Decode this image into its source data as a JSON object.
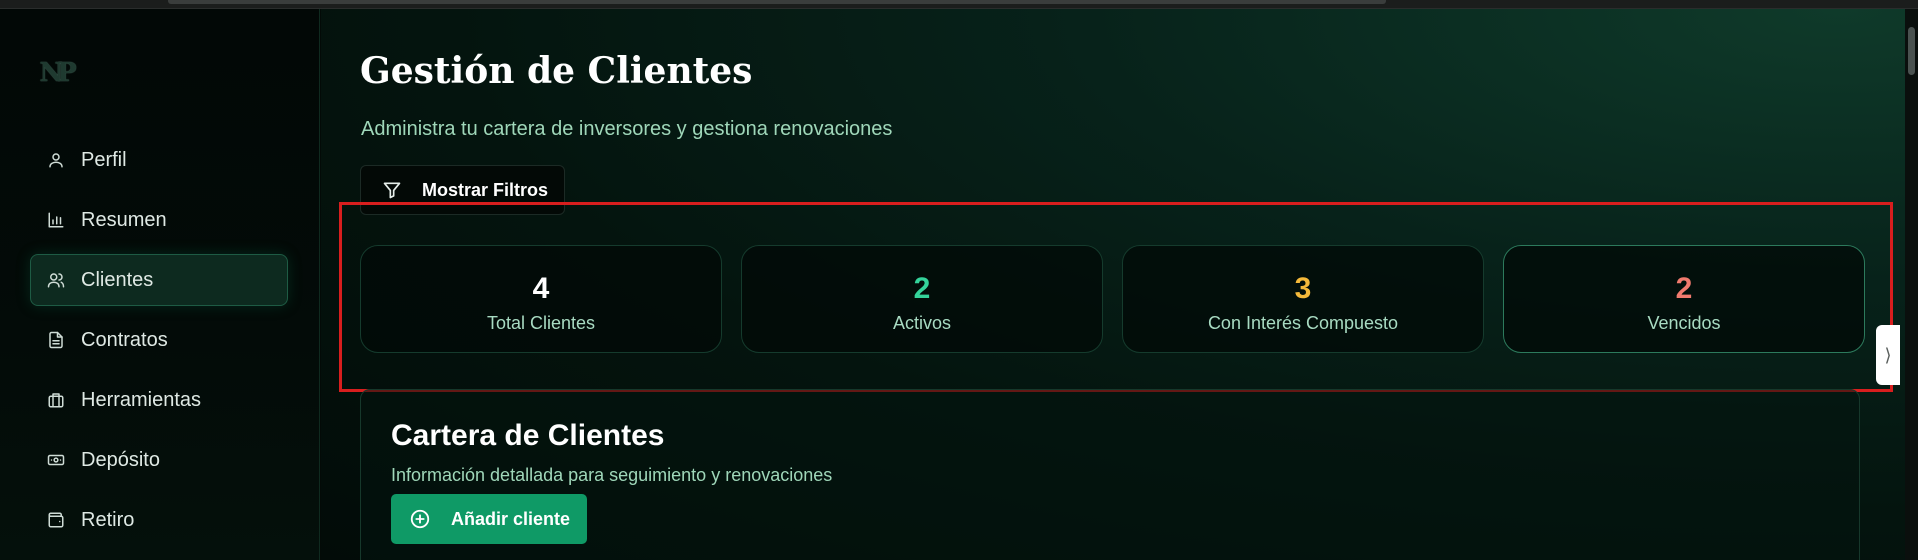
{
  "sidebar": {
    "logo_text": "NP",
    "items": [
      {
        "label": "Perfil",
        "icon": "user-icon"
      },
      {
        "label": "Resumen",
        "icon": "bar-chart-icon"
      },
      {
        "label": "Clientes",
        "icon": "users-icon",
        "active": true
      },
      {
        "label": "Contratos",
        "icon": "document-icon"
      },
      {
        "label": "Herramientas",
        "icon": "briefcase-icon"
      },
      {
        "label": "Depósito",
        "icon": "banknote-icon"
      },
      {
        "label": "Retiro",
        "icon": "wallet-icon"
      }
    ]
  },
  "header": {
    "title": "Gestión de Clientes",
    "subtitle": "Administra tu cartera de inversores y gestiona renovaciones"
  },
  "filters": {
    "button_label": "Mostrar Filtros",
    "icon": "filter-icon"
  },
  "stats": [
    {
      "value": "4",
      "label": "Total Clientes",
      "color": "#ffffff"
    },
    {
      "value": "2",
      "label": "Activos",
      "color": "#34d39a"
    },
    {
      "value": "3",
      "label": "Con Interés Compuesto",
      "color": "#f5b93a"
    },
    {
      "value": "2",
      "label": "Vencidos",
      "color": "#f07a6e"
    }
  ],
  "portfolio": {
    "title": "Cartera de Clientes",
    "subtitle": "Información detallada para seguimiento y renovaciones",
    "add_button_label": "Añadir cliente",
    "add_icon": "plus-circle-icon"
  },
  "colors": {
    "accent": "#0f9a66",
    "highlight_border": "#d81e1e",
    "active_nav_bg": "#0d2a1f"
  }
}
